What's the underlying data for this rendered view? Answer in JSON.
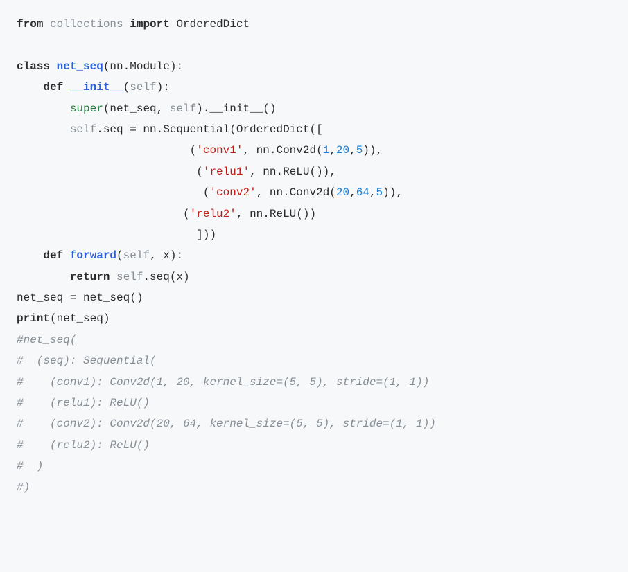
{
  "code": {
    "lines": [
      [
        {
          "t": "from ",
          "c": "kw"
        },
        {
          "t": "collections ",
          "c": "dim"
        },
        {
          "t": "import ",
          "c": "kw"
        },
        {
          "t": "OrderedDict",
          "c": "plain"
        }
      ],
      [
        {
          "t": "",
          "c": "plain"
        }
      ],
      [
        {
          "t": "class ",
          "c": "kw"
        },
        {
          "t": "net_seq",
          "c": "cls"
        },
        {
          "t": "(nn.Module):",
          "c": "plain"
        }
      ],
      [
        {
          "t": "    ",
          "c": "plain"
        },
        {
          "t": "def ",
          "c": "kw"
        },
        {
          "t": "__init__",
          "c": "fn"
        },
        {
          "t": "(",
          "c": "plain"
        },
        {
          "t": "self",
          "c": "slf"
        },
        {
          "t": "):",
          "c": "plain"
        }
      ],
      [
        {
          "t": "        ",
          "c": "plain"
        },
        {
          "t": "super",
          "c": "builtin"
        },
        {
          "t": "(net_seq, ",
          "c": "plain"
        },
        {
          "t": "self",
          "c": "slf"
        },
        {
          "t": ").__init__()",
          "c": "plain"
        }
      ],
      [
        {
          "t": "        ",
          "c": "plain"
        },
        {
          "t": "self",
          "c": "slf"
        },
        {
          "t": ".seq = nn.Sequential(OrderedDict([",
          "c": "plain"
        }
      ],
      [
        {
          "t": "                          (",
          "c": "plain"
        },
        {
          "t": "'conv1'",
          "c": "str"
        },
        {
          "t": ", nn.Conv2d(",
          "c": "plain"
        },
        {
          "t": "1",
          "c": "num"
        },
        {
          "t": ",",
          "c": "plain"
        },
        {
          "t": "20",
          "c": "num"
        },
        {
          "t": ",",
          "c": "plain"
        },
        {
          "t": "5",
          "c": "num"
        },
        {
          "t": ")),",
          "c": "plain"
        }
      ],
      [
        {
          "t": "                           (",
          "c": "plain"
        },
        {
          "t": "'relu1'",
          "c": "str"
        },
        {
          "t": ", nn.ReLU()),",
          "c": "plain"
        }
      ],
      [
        {
          "t": "                            (",
          "c": "plain"
        },
        {
          "t": "'conv2'",
          "c": "str"
        },
        {
          "t": ", nn.Conv2d(",
          "c": "plain"
        },
        {
          "t": "20",
          "c": "num"
        },
        {
          "t": ",",
          "c": "plain"
        },
        {
          "t": "64",
          "c": "num"
        },
        {
          "t": ",",
          "c": "plain"
        },
        {
          "t": "5",
          "c": "num"
        },
        {
          "t": ")),",
          "c": "plain"
        }
      ],
      [
        {
          "t": "                         (",
          "c": "plain"
        },
        {
          "t": "'relu2'",
          "c": "str"
        },
        {
          "t": ", nn.ReLU())",
          "c": "plain"
        }
      ],
      [
        {
          "t": "                           ]))",
          "c": "plain"
        }
      ],
      [
        {
          "t": "    ",
          "c": "plain"
        },
        {
          "t": "def ",
          "c": "kw"
        },
        {
          "t": "forward",
          "c": "fn"
        },
        {
          "t": "(",
          "c": "plain"
        },
        {
          "t": "self",
          "c": "slf"
        },
        {
          "t": ", x):",
          "c": "plain"
        }
      ],
      [
        {
          "t": "        ",
          "c": "plain"
        },
        {
          "t": "return ",
          "c": "kw"
        },
        {
          "t": "self",
          "c": "slf"
        },
        {
          "t": ".seq(x)",
          "c": "plain"
        }
      ],
      [
        {
          "t": "net_seq = net_seq()",
          "c": "plain"
        }
      ],
      [
        {
          "t": "print",
          "c": "kw"
        },
        {
          "t": "(net_seq)",
          "c": "plain"
        }
      ],
      [
        {
          "t": "#net_seq(",
          "c": "comment"
        }
      ],
      [
        {
          "t": "#  (seq): Sequential(",
          "c": "comment"
        }
      ],
      [
        {
          "t": "#    (conv1): Conv2d(1, 20, kernel_size=(5, 5), stride=(1, 1))",
          "c": "comment"
        }
      ],
      [
        {
          "t": "#    (relu1): ReLU()",
          "c": "comment"
        }
      ],
      [
        {
          "t": "#    (conv2): Conv2d(20, 64, kernel_size=(5, 5), stride=(1, 1))",
          "c": "comment"
        }
      ],
      [
        {
          "t": "#    (relu2): ReLU()",
          "c": "comment"
        }
      ],
      [
        {
          "t": "#  )",
          "c": "comment"
        }
      ],
      [
        {
          "t": "#)",
          "c": "comment"
        }
      ]
    ]
  }
}
